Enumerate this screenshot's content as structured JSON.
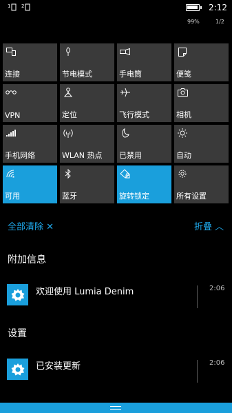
{
  "status_bar": {
    "time": "2:12",
    "battery_percent": "99%",
    "page_indicator": "1/2",
    "sim1_label": "1",
    "sim2_label": "2"
  },
  "quick_actions": [
    {
      "label": "连接",
      "icon": "project-connect-icon",
      "active": false
    },
    {
      "label": "节电模式",
      "icon": "battery-saver-icon",
      "active": false
    },
    {
      "label": "手电筒",
      "icon": "flashlight-icon",
      "active": false
    },
    {
      "label": "便笺",
      "icon": "note-icon",
      "active": false
    },
    {
      "label": "VPN",
      "icon": "vpn-icon",
      "active": false
    },
    {
      "label": "定位",
      "icon": "location-icon",
      "active": false
    },
    {
      "label": "飞行模式",
      "icon": "airplane-icon",
      "active": false
    },
    {
      "label": "相机",
      "icon": "camera-icon",
      "active": false
    },
    {
      "label": "手机网络",
      "icon": "cellular-icon",
      "active": false
    },
    {
      "label": "WLAN 热点",
      "icon": "hotspot-icon",
      "active": false
    },
    {
      "label": "已禁用",
      "icon": "quiet-hours-icon",
      "active": false
    },
    {
      "label": "自动",
      "icon": "brightness-icon",
      "active": false
    },
    {
      "label": "可用",
      "icon": "wifi-icon",
      "active": true
    },
    {
      "label": "蓝牙",
      "icon": "bluetooth-icon",
      "active": false
    },
    {
      "label": "旋转锁定",
      "icon": "rotation-lock-icon",
      "active": true
    },
    {
      "label": "所有设置",
      "icon": "gear-icon",
      "active": false
    }
  ],
  "actions": {
    "clear_all": "全部清除 ✕",
    "collapse": "折叠 ︿"
  },
  "sections": [
    {
      "title": "附加信息",
      "notification": {
        "text": "欢迎使用 Lumia Denim",
        "time": "2:06",
        "icon": "gear-icon"
      }
    },
    {
      "title": "设置",
      "notification": {
        "text": "已安装更新",
        "time": "2:06",
        "icon": "gear-icon"
      }
    }
  ],
  "colors": {
    "accent": "#1a9fdc",
    "tile": "#3a3a3a",
    "link": "#1ea9ec"
  }
}
